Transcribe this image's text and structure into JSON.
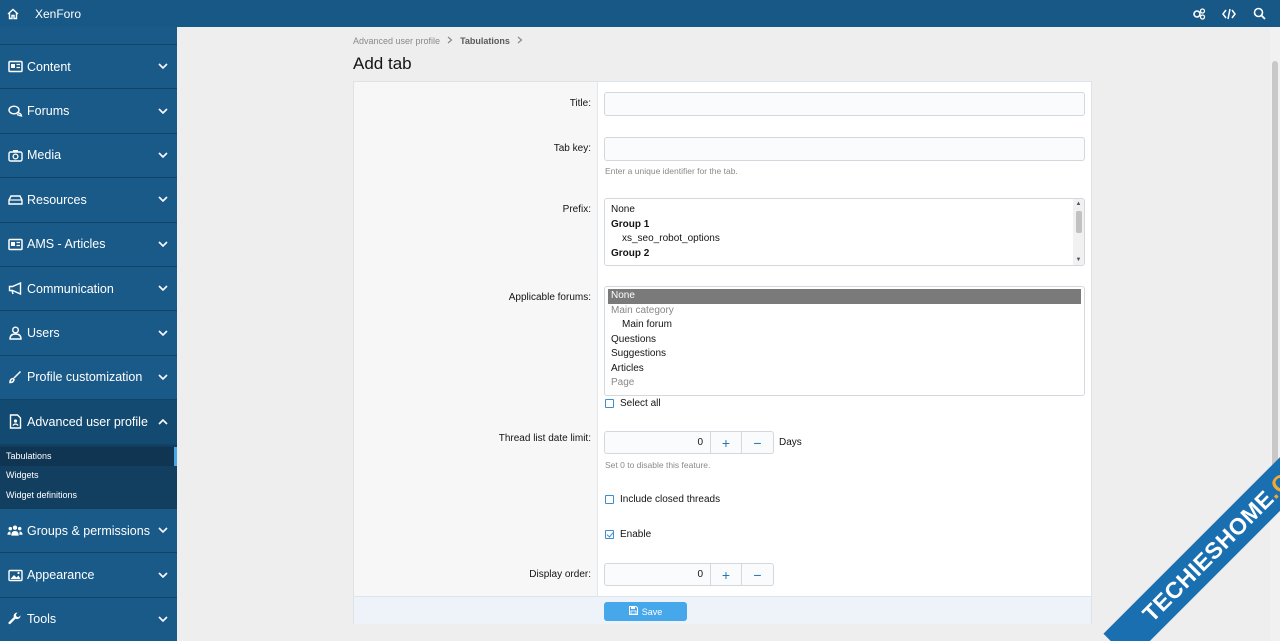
{
  "topbar": {
    "brand": "XenForo"
  },
  "sidebar": {
    "items": [
      {
        "label": "Content",
        "icon": "content-icon",
        "expanded": false
      },
      {
        "label": "Forums",
        "icon": "forums-icon",
        "expanded": false
      },
      {
        "label": "Media",
        "icon": "camera-icon",
        "expanded": false
      },
      {
        "label": "Resources",
        "icon": "resources-icon",
        "expanded": false
      },
      {
        "label": "AMS - Articles",
        "icon": "articles-icon",
        "expanded": false
      },
      {
        "label": "Communication",
        "icon": "megaphone-icon",
        "expanded": false
      },
      {
        "label": "Users",
        "icon": "user-icon",
        "expanded": false
      },
      {
        "label": "Profile customization",
        "icon": "brush-icon",
        "expanded": false
      },
      {
        "label": "Advanced user profile",
        "icon": "profile-doc-icon",
        "expanded": true
      },
      {
        "label": "Groups & permissions",
        "icon": "groups-icon",
        "expanded": false
      },
      {
        "label": "Appearance",
        "icon": "image-icon",
        "expanded": false
      },
      {
        "label": "Tools",
        "icon": "wrench-icon",
        "expanded": false
      }
    ],
    "subitems": [
      "Tabulations",
      "Widgets",
      "Widget definitions"
    ]
  },
  "breadcrumb": {
    "parent": "Advanced user profile",
    "current": "Tabulations"
  },
  "page": {
    "title": "Add tab"
  },
  "form": {
    "title_label": "Title:",
    "title_value": "",
    "tabkey_label": "Tab key:",
    "tabkey_value": "",
    "tabkey_hint": "Enter a unique identifier for the tab.",
    "prefix_label": "Prefix:",
    "prefix_options": [
      {
        "text": "None",
        "type": "opt"
      },
      {
        "text": "Group 1",
        "type": "group"
      },
      {
        "text": "xs_seo_robot_options",
        "type": "ind"
      },
      {
        "text": "Group 2",
        "type": "group"
      }
    ],
    "forums_label": "Applicable forums:",
    "forums_options": [
      {
        "text": "None",
        "type": "sel"
      },
      {
        "text": "Main category",
        "type": "dim"
      },
      {
        "text": "Main forum",
        "type": "ind"
      },
      {
        "text": "Questions",
        "type": "opt"
      },
      {
        "text": "Suggestions",
        "type": "opt"
      },
      {
        "text": "Articles",
        "type": "opt"
      },
      {
        "text": "Page",
        "type": "dim"
      }
    ],
    "select_all": "Select all",
    "date_limit_label": "Thread list date limit:",
    "date_limit_value": "0",
    "date_limit_unit": "Days",
    "date_limit_hint": "Set 0 to disable this feature.",
    "include_closed": "Include closed threads",
    "enable": "Enable",
    "display_order_label": "Display order:",
    "display_order_value": "0",
    "plus": "+",
    "minus": "−",
    "save": "Save"
  },
  "watermark": {
    "text": "TECHIESHOME",
    "suffix": ".COM"
  },
  "colors": {
    "topbar": "#185886",
    "sidebar": "#1a5a88",
    "accent": "#47a7eb"
  }
}
